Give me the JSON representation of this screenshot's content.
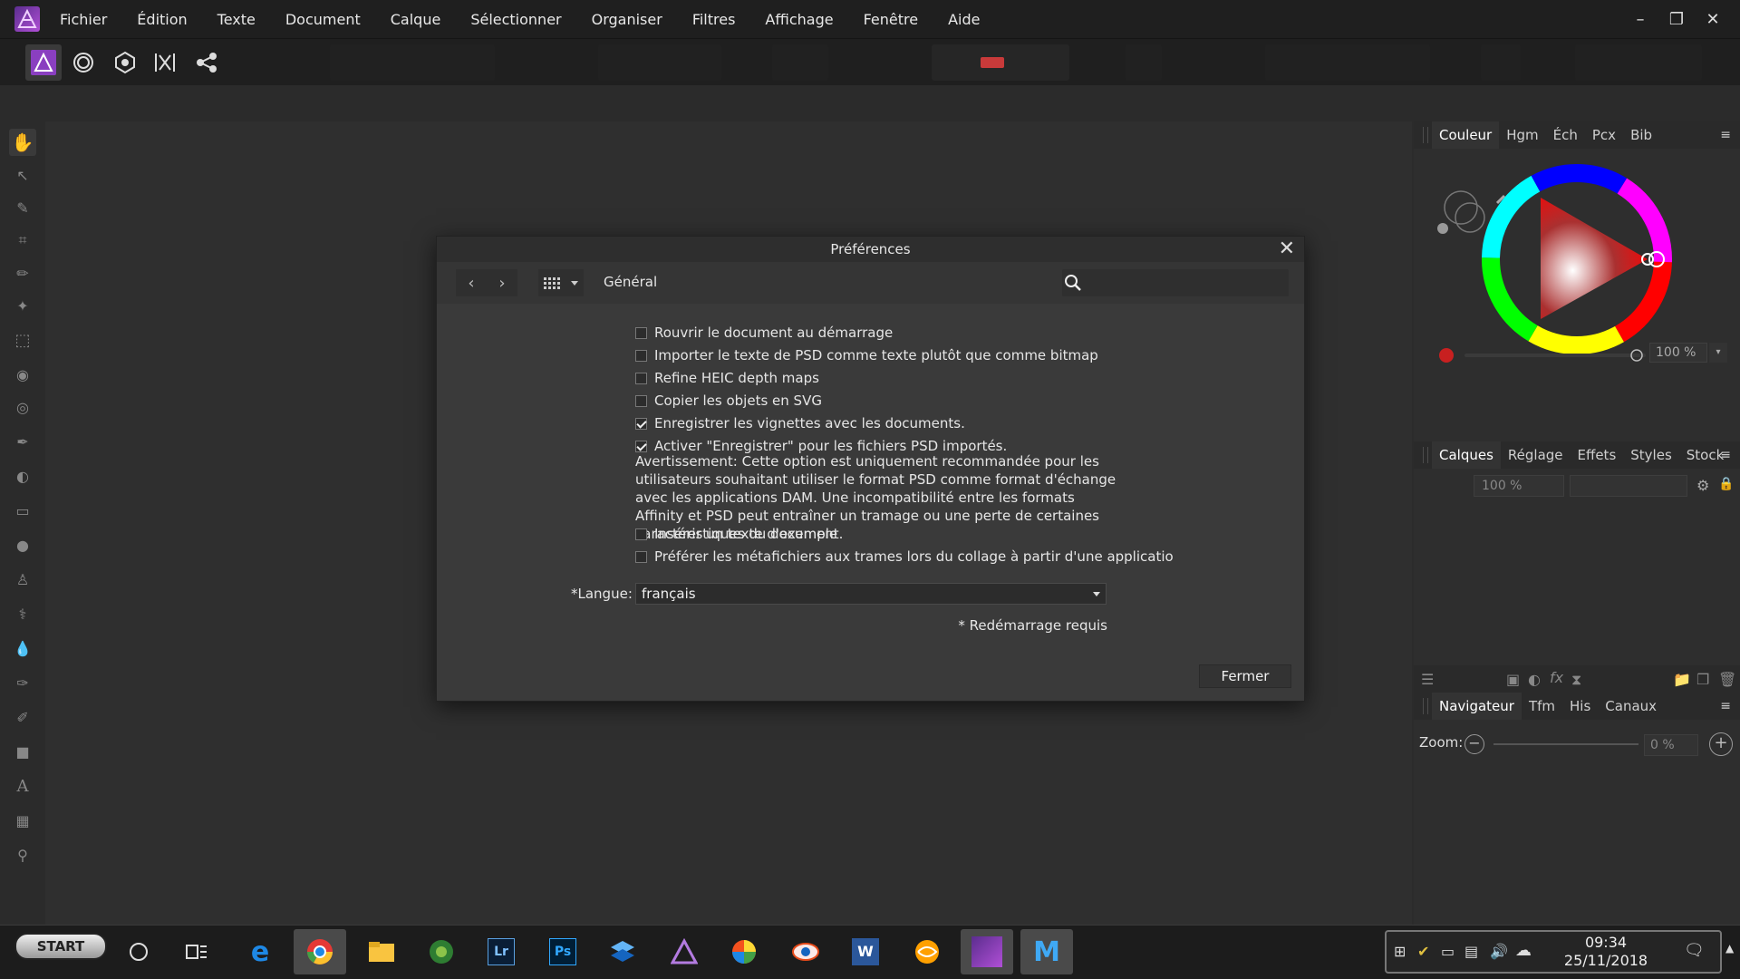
{
  "menu": {
    "items": [
      "Fichier",
      "Édition",
      "Texte",
      "Document",
      "Calque",
      "Sélectionner",
      "Organiser",
      "Filtres",
      "Affichage",
      "Fenêtre",
      "Aide"
    ]
  },
  "panels": {
    "color": {
      "tabs": [
        "Couleur",
        "Hgm",
        "Éch",
        "Pcx",
        "Bib"
      ],
      "opacity_value": "100 %",
      "accent": "#d82020"
    },
    "layers": {
      "tabs": [
        "Calques",
        "Réglage",
        "Effets",
        "Styles",
        "Stock"
      ],
      "opacity_value": "100 %"
    },
    "navigator": {
      "tabs": [
        "Navigateur",
        "Tfm",
        "His",
        "Canaux"
      ],
      "zoom_label": "Zoom:",
      "zoom_value": "0 %"
    }
  },
  "dialog": {
    "title": "Préférences",
    "section": "Général",
    "options": [
      {
        "label": "Rouvrir le document au démarrage",
        "checked": false
      },
      {
        "label": "Importer le texte de PSD comme texte plutôt que comme bitmap",
        "checked": false
      },
      {
        "label": "Refine HEIC depth maps",
        "checked": false
      },
      {
        "label": "Copier les objets en SVG",
        "checked": false
      },
      {
        "label": "Enregistrer les vignettes avec les documents.",
        "checked": true
      },
      {
        "label": "Activer \"Enregistrer\" pour les fichiers PSD importés.",
        "checked": true
      }
    ],
    "warning": "Avertissement: Cette option est uniquement recommandée pour les utilisateurs souhaitant utiliser le format PSD comme format d'échange avec les applications DAM. Une incompatibilité entre les formats Affinity et PSD peut entraîner un tramage ou une perte de certaines caractéristiques du document.",
    "options2": [
      {
        "label": "Insérer un texte d'exemple",
        "checked": false
      },
      {
        "label": "Préférer les métafichiers aux trames lors du collage à partir d'une applicatio",
        "checked": false
      }
    ],
    "language_label": "*Langue:",
    "language_value": "français",
    "restart_note": "* Redémarrage requis",
    "close_label": "Fermer"
  },
  "taskbar": {
    "start_label": "START",
    "time": "09:34",
    "date": "25/11/2018"
  }
}
